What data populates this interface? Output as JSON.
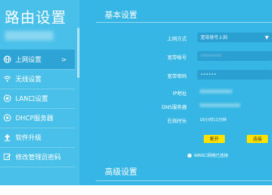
{
  "sidebar": {
    "title": "路由设置",
    "items": [
      {
        "label": "上网设置",
        "icon": "globe-icon",
        "active": true
      },
      {
        "label": "无线设置",
        "icon": "wifi-icon",
        "active": false
      },
      {
        "label": "LAN口设置",
        "icon": "lan-port-icon",
        "active": false
      },
      {
        "label": "DHCP服务器",
        "icon": "dhcp-server-icon",
        "active": false
      },
      {
        "label": "软件升级",
        "icon": "upload-icon",
        "active": false
      },
      {
        "label": "修改管理员密码",
        "icon": "edit-icon",
        "active": false
      }
    ]
  },
  "main": {
    "basic_title": "基本设置",
    "advanced_title": "高级设置",
    "form": {
      "connection_type_label": "上网方式",
      "connection_type_value": "宽带拨号上网",
      "account_label": "宽带帐号",
      "account_value": "••••••••",
      "password_label": "宽带密码",
      "password_value": "••••••",
      "ip_label": "IP地址",
      "dns_label": "DNS服务器",
      "online_time_label": "在线时长",
      "online_time_value": "16小时11分钟"
    },
    "buttons": {
      "disconnect": "断开",
      "connect": "连接"
    },
    "radio_label": "WAN口网络已连接"
  },
  "colors": {
    "main_bg": "#35b6e4",
    "sidebar_bg": "#49c0ea",
    "active_item_bg": "#2da3d6",
    "field_bg": "#2a9fd1",
    "button_bg": "#ffe100"
  }
}
